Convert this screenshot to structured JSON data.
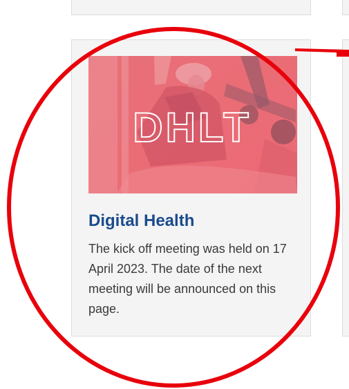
{
  "card": {
    "image_label": "DHLT",
    "title": "Digital Health",
    "description": "The kick off meeting was held on 17 April 2023. The date of the next meeting will be announced on this page."
  },
  "annotation": {
    "shape": "ellipse",
    "color": "#e8000b",
    "arrow_color": "#e8000b"
  },
  "colors": {
    "title": "#1a4b8c",
    "image_tint": "#ea6e76",
    "card_background": "#f4f4f4"
  }
}
